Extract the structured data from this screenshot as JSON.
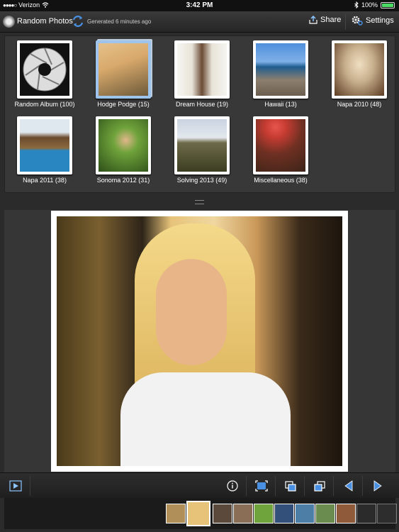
{
  "status_bar": {
    "signal": "●●●●○",
    "carrier": "Verizon",
    "time": "3:42 PM",
    "battery_percent": "100%",
    "battery_level": 1.0
  },
  "toolbar": {
    "title": "Random Photos",
    "status": "Generated 6 minutes ago",
    "share_label": "Share",
    "settings_label": "Settings"
  },
  "albums": [
    {
      "label": "Random Album (100)",
      "colors": [
        "#111111",
        "#e8e8e8"
      ]
    },
    {
      "label": "Hodge Podge (15)",
      "colors": [
        "#e5c18a",
        "#6d5a3a"
      ]
    },
    {
      "label": "Dream House (19)",
      "colors": [
        "#f5f5f0",
        "#6b4b34"
      ]
    },
    {
      "label": "Hawaii (13)",
      "colors": [
        "#4f8fdb",
        "#8d7f6e"
      ]
    },
    {
      "label": "Napa 2010 (48)",
      "colors": [
        "#c8b08d",
        "#5c3b22"
      ]
    },
    {
      "label": "Napa 2011 (38)",
      "colors": [
        "#dfe8ef",
        "#2a86c1"
      ]
    },
    {
      "label": "Sonoma 2012 (31)",
      "colors": [
        "#6fa33b",
        "#2d4f18"
      ]
    },
    {
      "label": "Solving 2013 (49)",
      "colors": [
        "#c9d3df",
        "#3b3d22"
      ]
    },
    {
      "label": "Miscellaneous (38)",
      "colors": [
        "#c53b32",
        "#3c2418"
      ]
    }
  ],
  "colors": {
    "selected_album": "#9fc4ec",
    "accent": "#4a90e2"
  },
  "filmstrip": [
    "#b08f58",
    "#e7c37a",
    "#5b4a3b",
    "#8a6f56",
    "#6fa33b",
    "#32507a",
    "#4d7fa6",
    "#6a8c4e",
    "#8e5a3a",
    "#3c3c3c",
    "#4a4a4a"
  ]
}
